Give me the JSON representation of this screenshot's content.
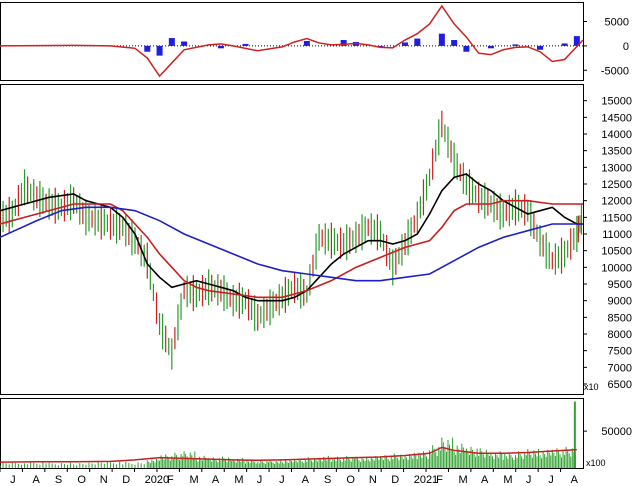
{
  "chart_data": [
    {
      "type": "line",
      "panel": "oscillator",
      "ylim": [
        -7000,
        9000
      ],
      "y_ticks": [
        5000,
        0,
        -5000
      ],
      "y_tick_labels": [
        "5000",
        "0",
        "-5000"
      ],
      "series": [
        {
          "role": "oscillator-line",
          "color": "#d02020",
          "x": [
            0,
            6,
            12,
            18,
            22,
            24,
            26,
            28,
            30,
            34,
            36,
            38,
            42,
            44,
            46,
            48,
            50,
            52,
            54,
            56,
            58,
            60,
            62,
            64,
            66,
            68,
            70,
            72,
            74,
            76,
            78,
            80,
            82,
            84,
            86,
            88,
            90,
            92,
            95
          ],
          "y": [
            0,
            50,
            100,
            0,
            -500,
            -2500,
            -6200,
            -3500,
            -800,
            200,
            400,
            0,
            -1000,
            -600,
            -200,
            800,
            1500,
            600,
            200,
            300,
            500,
            200,
            -300,
            -400,
            1200,
            2500,
            4500,
            8200,
            4500,
            1800,
            -1500,
            -1800,
            -800,
            -300,
            -200,
            -1200,
            -3200,
            -2800,
            1200
          ]
        },
        {
          "role": "histogram",
          "color": "#1e1ee0",
          "x": [
            24,
            26,
            28,
            30,
            36,
            40,
            50,
            56,
            58,
            62,
            66,
            68,
            72,
            74,
            76,
            80,
            84,
            88,
            92,
            94
          ],
          "y": [
            -1200,
            -2000,
            1600,
            900,
            -500,
            400,
            1000,
            1200,
            800,
            -300,
            700,
            1500,
            2500,
            1200,
            -1200,
            -500,
            300,
            -800,
            500,
            2000
          ]
        }
      ]
    },
    {
      "type": "line",
      "panel": "price",
      "ylim": [
        6200,
        15500
      ],
      "y_ticks": [
        15000,
        14500,
        14000,
        13500,
        13000,
        12500,
        12000,
        11500,
        11000,
        10500,
        10000,
        9500,
        9000,
        8500,
        8000,
        7500,
        7000,
        6500
      ],
      "y_tick_labels": [
        "15000",
        "14500",
        "14000",
        "13500",
        "13000",
        "12500",
        "12000",
        "11500",
        "11000",
        "10500",
        "10000",
        "9500",
        "9000",
        "8500",
        "8000",
        "7500",
        "7000",
        "6500"
      ],
      "unit_label": "x10",
      "series": [
        {
          "role": "price",
          "color": "#2a9a2a",
          "x": [
            0,
            2,
            4,
            6,
            8,
            10,
            12,
            14,
            16,
            18,
            20,
            22,
            24,
            26,
            28,
            30,
            32,
            34,
            36,
            38,
            40,
            42,
            44,
            46,
            48,
            50,
            52,
            54,
            56,
            58,
            60,
            62,
            64,
            66,
            68,
            70,
            72,
            74,
            76,
            78,
            80,
            82,
            84,
            86,
            88,
            90,
            92,
            94,
            95
          ],
          "y": [
            11500,
            11600,
            12400,
            12100,
            11900,
            11800,
            12000,
            11500,
            11400,
            11300,
            11200,
            10800,
            10200,
            8300,
            7400,
            9300,
            9200,
            9400,
            9300,
            9000,
            9000,
            8500,
            8800,
            9100,
            9400,
            9200,
            10900,
            10800,
            10700,
            10900,
            11200,
            11000,
            10000,
            10700,
            11500,
            12700,
            14300,
            13200,
            12500,
            12100,
            11900,
            11600,
            11800,
            11700,
            10800,
            10200,
            10400,
            11000,
            11600
          ]
        },
        {
          "role": "ma-short",
          "color": "#000000",
          "x": [
            0,
            4,
            8,
            12,
            14,
            18,
            20,
            22,
            24,
            26,
            28,
            30,
            32,
            34,
            36,
            38,
            40,
            42,
            44,
            46,
            48,
            50,
            52,
            54,
            56,
            58,
            60,
            62,
            64,
            66,
            68,
            70,
            72,
            74,
            76,
            78,
            80,
            82,
            84,
            86,
            88,
            90,
            92,
            94,
            95
          ],
          "y": [
            11700,
            11900,
            12100,
            12200,
            12000,
            11800,
            11500,
            11000,
            10100,
            9700,
            9400,
            9500,
            9600,
            9500,
            9400,
            9300,
            9100,
            9000,
            9000,
            9000,
            9100,
            9300,
            9700,
            10100,
            10400,
            10600,
            10800,
            10800,
            10700,
            10800,
            11000,
            11600,
            12300,
            12700,
            12800,
            12500,
            12300,
            12000,
            11800,
            11600,
            11700,
            11800,
            11500,
            11300,
            11300
          ]
        },
        {
          "role": "ma-medium",
          "color": "#c81e1e",
          "x": [
            0,
            6,
            12,
            18,
            20,
            22,
            24,
            26,
            28,
            30,
            32,
            34,
            38,
            42,
            46,
            50,
            54,
            58,
            62,
            66,
            70,
            72,
            74,
            76,
            78,
            80,
            82,
            86,
            90,
            94,
            95
          ],
          "y": [
            11300,
            11600,
            11900,
            11900,
            11700,
            11300,
            10900,
            10400,
            10000,
            9600,
            9400,
            9300,
            9200,
            9100,
            9100,
            9300,
            9600,
            10000,
            10300,
            10600,
            10800,
            11200,
            11700,
            11900,
            11900,
            11900,
            12000,
            12000,
            11900,
            11900,
            11900
          ]
        },
        {
          "role": "ma-long",
          "color": "#1f1fc8",
          "x": [
            0,
            6,
            10,
            14,
            18,
            22,
            26,
            30,
            34,
            38,
            42,
            46,
            50,
            54,
            58,
            62,
            66,
            70,
            74,
            78,
            82,
            86,
            90,
            94,
            95
          ],
          "y": [
            10900,
            11400,
            11700,
            11800,
            11800,
            11700,
            11400,
            11000,
            10700,
            10400,
            10100,
            9900,
            9800,
            9700,
            9600,
            9600,
            9700,
            9800,
            10200,
            10600,
            10900,
            11100,
            11300,
            11300,
            11300
          ]
        }
      ]
    },
    {
      "type": "bar",
      "panel": "volume",
      "ylim": [
        0,
        95000
      ],
      "y_ticks": [
        50000
      ],
      "y_tick_labels": [
        "50000"
      ],
      "unit_label": "x100",
      "categories": [
        "J",
        "A",
        "S",
        "O",
        "N",
        "D",
        "2020",
        "F",
        "M",
        "A",
        "M",
        "J",
        "J",
        "A",
        "S",
        "O",
        "N",
        "D",
        "2021",
        "F",
        "M",
        "A",
        "M",
        "J",
        "J",
        "A"
      ],
      "series": [
        {
          "role": "volume",
          "color": "#2fa02f",
          "x": [
            0,
            4,
            8,
            12,
            16,
            20,
            24,
            26,
            28,
            30,
            32,
            34,
            36,
            38,
            40,
            42,
            44,
            46,
            48,
            50,
            52,
            54,
            56,
            58,
            60,
            62,
            64,
            66,
            68,
            70,
            72,
            74,
            76,
            78,
            80,
            82,
            84,
            86,
            88,
            90,
            92,
            94
          ],
          "y": [
            8000,
            8000,
            7000,
            7000,
            9000,
            8000,
            12000,
            18000,
            20000,
            22000,
            16000,
            14000,
            15000,
            13000,
            11000,
            10000,
            10000,
            11000,
            12000,
            14000,
            16000,
            15000,
            16000,
            15000,
            16000,
            17000,
            19000,
            20000,
            22000,
            30000,
            40000,
            32000,
            28000,
            26000,
            22000,
            20000,
            22000,
            25000,
            24000,
            26000,
            28000,
            90000
          ]
        },
        {
          "role": "volume-ma",
          "color": "#c81e1e",
          "x": [
            0,
            6,
            12,
            18,
            22,
            26,
            30,
            34,
            38,
            42,
            46,
            50,
            54,
            58,
            62,
            66,
            70,
            72,
            74,
            76,
            78,
            82,
            86,
            90,
            94
          ],
          "y": [
            8000,
            8500,
            8500,
            9000,
            11000,
            14000,
            13000,
            12000,
            11000,
            10500,
            11000,
            12000,
            13000,
            14000,
            15000,
            17000,
            20000,
            28000,
            24000,
            22000,
            20000,
            20000,
            21000,
            23000,
            25000
          ]
        }
      ]
    }
  ]
}
